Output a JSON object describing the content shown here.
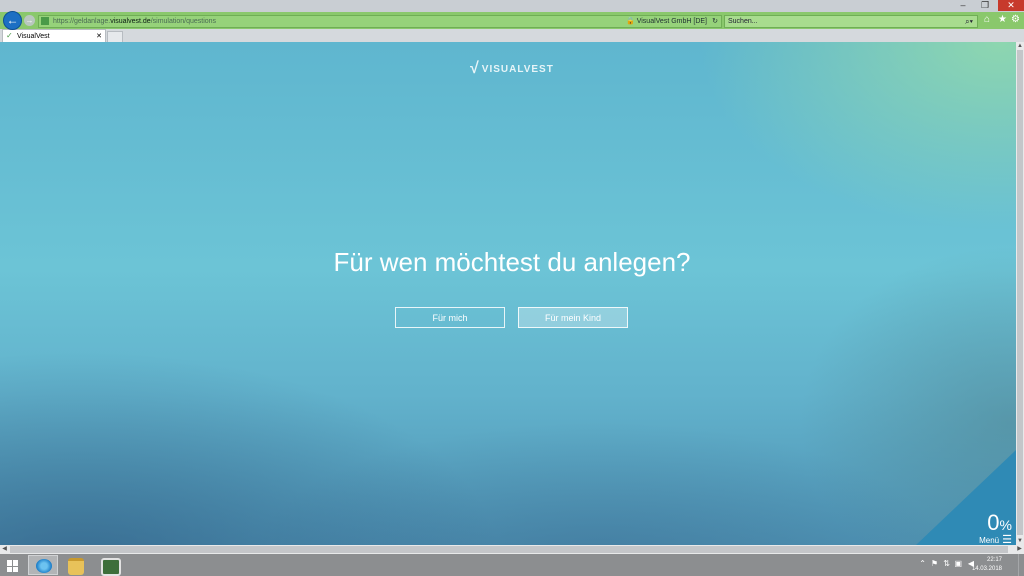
{
  "browser": {
    "url_prefix": "https://",
    "url_sub": "geldanlage.",
    "url_domain": "visualvest.de",
    "url_path": "/simulation/questions",
    "certificate": "VisualVest GmbH [DE]",
    "search_placeholder": "Suchen...",
    "tab_label": "VisualVest"
  },
  "page": {
    "logo_text": "VISUALVEST",
    "question": "Für wen möchtest du anlegen?",
    "answers": [
      "Für mich",
      "Für mein Kind"
    ],
    "progress_value": "0",
    "progress_symbol": "%",
    "menu_label": "Menü"
  },
  "taskbar": {
    "time": "22:17",
    "date": "14.03.2018"
  },
  "colors": {
    "addressbar": "#8ac86c",
    "corner": "#2f8ab5",
    "page_bg": "#6cc4d6"
  }
}
